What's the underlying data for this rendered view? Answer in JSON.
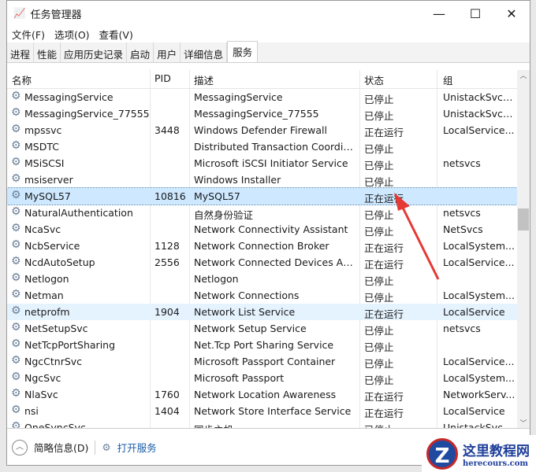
{
  "window": {
    "title": "任务管理器",
    "minimize": "—",
    "maximize": "☐",
    "close": "✕"
  },
  "menu": [
    "文件(F)",
    "选项(O)",
    "查看(V)"
  ],
  "tabs": [
    "进程",
    "性能",
    "应用历史记录",
    "启动",
    "用户",
    "详细信息",
    "服务"
  ],
  "columns": [
    "名称",
    "PID",
    "描述",
    "状态",
    "组"
  ],
  "rows": [
    [
      "MessagingService",
      "",
      "MessagingService",
      "已停止",
      "UnistackSvcG..."
    ],
    [
      "MessagingService_77555",
      "",
      "MessagingService_77555",
      "已停止",
      "UnistackSvcG..."
    ],
    [
      "mpssvc",
      "3448",
      "Windows Defender Firewall",
      "正在运行",
      "LocalService..."
    ],
    [
      "MSDTC",
      "",
      "Distributed Transaction Coordinator",
      "已停止",
      ""
    ],
    [
      "MSiSCSI",
      "",
      "Microsoft iSCSI Initiator Service",
      "已停止",
      "netsvcs"
    ],
    [
      "msiserver",
      "",
      "Windows Installer",
      "已停止",
      ""
    ],
    [
      "MySQL57",
      "10816",
      "MySQL57",
      "正在运行",
      ""
    ],
    [
      "NaturalAuthentication",
      "",
      "自然身份验证",
      "已停止",
      "netsvcs"
    ],
    [
      "NcaSvc",
      "",
      "Network Connectivity Assistant",
      "已停止",
      "NetSvcs"
    ],
    [
      "NcbService",
      "1128",
      "Network Connection Broker",
      "正在运行",
      "LocalSystem..."
    ],
    [
      "NcdAutoSetup",
      "2556",
      "Network Connected Devices Auto-Setup",
      "正在运行",
      "LocalService..."
    ],
    [
      "Netlogon",
      "",
      "Netlogon",
      "已停止",
      ""
    ],
    [
      "Netman",
      "",
      "Network Connections",
      "已停止",
      "LocalSystem..."
    ],
    [
      "netprofm",
      "1904",
      "Network List Service",
      "正在运行",
      "LocalService"
    ],
    [
      "NetSetupSvc",
      "",
      "Network Setup Service",
      "已停止",
      "netsvcs"
    ],
    [
      "NetTcpPortSharing",
      "",
      "Net.Tcp Port Sharing Service",
      "已停止",
      ""
    ],
    [
      "NgcCtnrSvc",
      "",
      "Microsoft Passport Container",
      "已停止",
      "LocalService..."
    ],
    [
      "NgcSvc",
      "",
      "Microsoft Passport",
      "已停止",
      "LocalSystem..."
    ],
    [
      "NlaSvc",
      "1760",
      "Network Location Awareness",
      "正在运行",
      "NetworkServ..."
    ],
    [
      "nsi",
      "1404",
      "Network Store Interface Service",
      "正在运行",
      "LocalService"
    ],
    [
      "OneSyncSvc",
      "",
      "同步主机",
      "已停止",
      "UnistackSvcG..."
    ]
  ],
  "footer": {
    "summary": "简略信息(D)",
    "open_services": "打开服务"
  },
  "watermark": {
    "title": "这里教程网",
    "url": "herecours.com",
    "letter": "Z"
  }
}
